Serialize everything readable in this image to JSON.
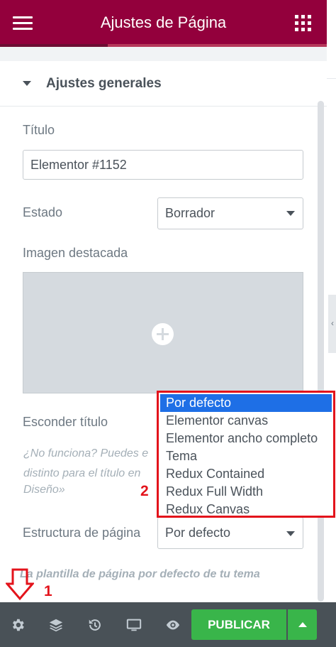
{
  "header": {
    "title": "Ajustes de Página"
  },
  "section": {
    "title": "Ajustes generales"
  },
  "fields": {
    "title_label": "Título",
    "title_value": "Elementor #1152",
    "status_label": "Estado",
    "status_value": "Borrador",
    "featured_image_label": "Imagen destacada",
    "hide_title_label": "Esconder título",
    "hide_title_note_line1": "¿No funciona? Puedes e",
    "hide_title_note_line2": "distinto para el título en",
    "hide_title_note_line3": "Diseño»",
    "page_layout_label": "Estructura de página",
    "page_layout_value": "Por defecto",
    "page_layout_note": "La plantilla de página por defecto de tu tema"
  },
  "dropdown": {
    "options": [
      "Por defecto",
      "Elementor canvas",
      "Elementor ancho completo",
      "Tema",
      "Redux Contained",
      "Redux Full Width",
      "Redux Canvas"
    ],
    "selected": "Por defecto"
  },
  "annotations": {
    "one": "1",
    "two": "2"
  },
  "footer": {
    "icons": [
      "gear-icon",
      "layers-icon",
      "history-icon",
      "responsive-icon",
      "preview-eye-icon"
    ],
    "publish_label": "PUBLICAR"
  },
  "colors": {
    "header": "#93003c",
    "publish": "#39b54a",
    "footer": "#495157",
    "highlight": "#1e6fe6",
    "annotation": "#e3131b"
  }
}
